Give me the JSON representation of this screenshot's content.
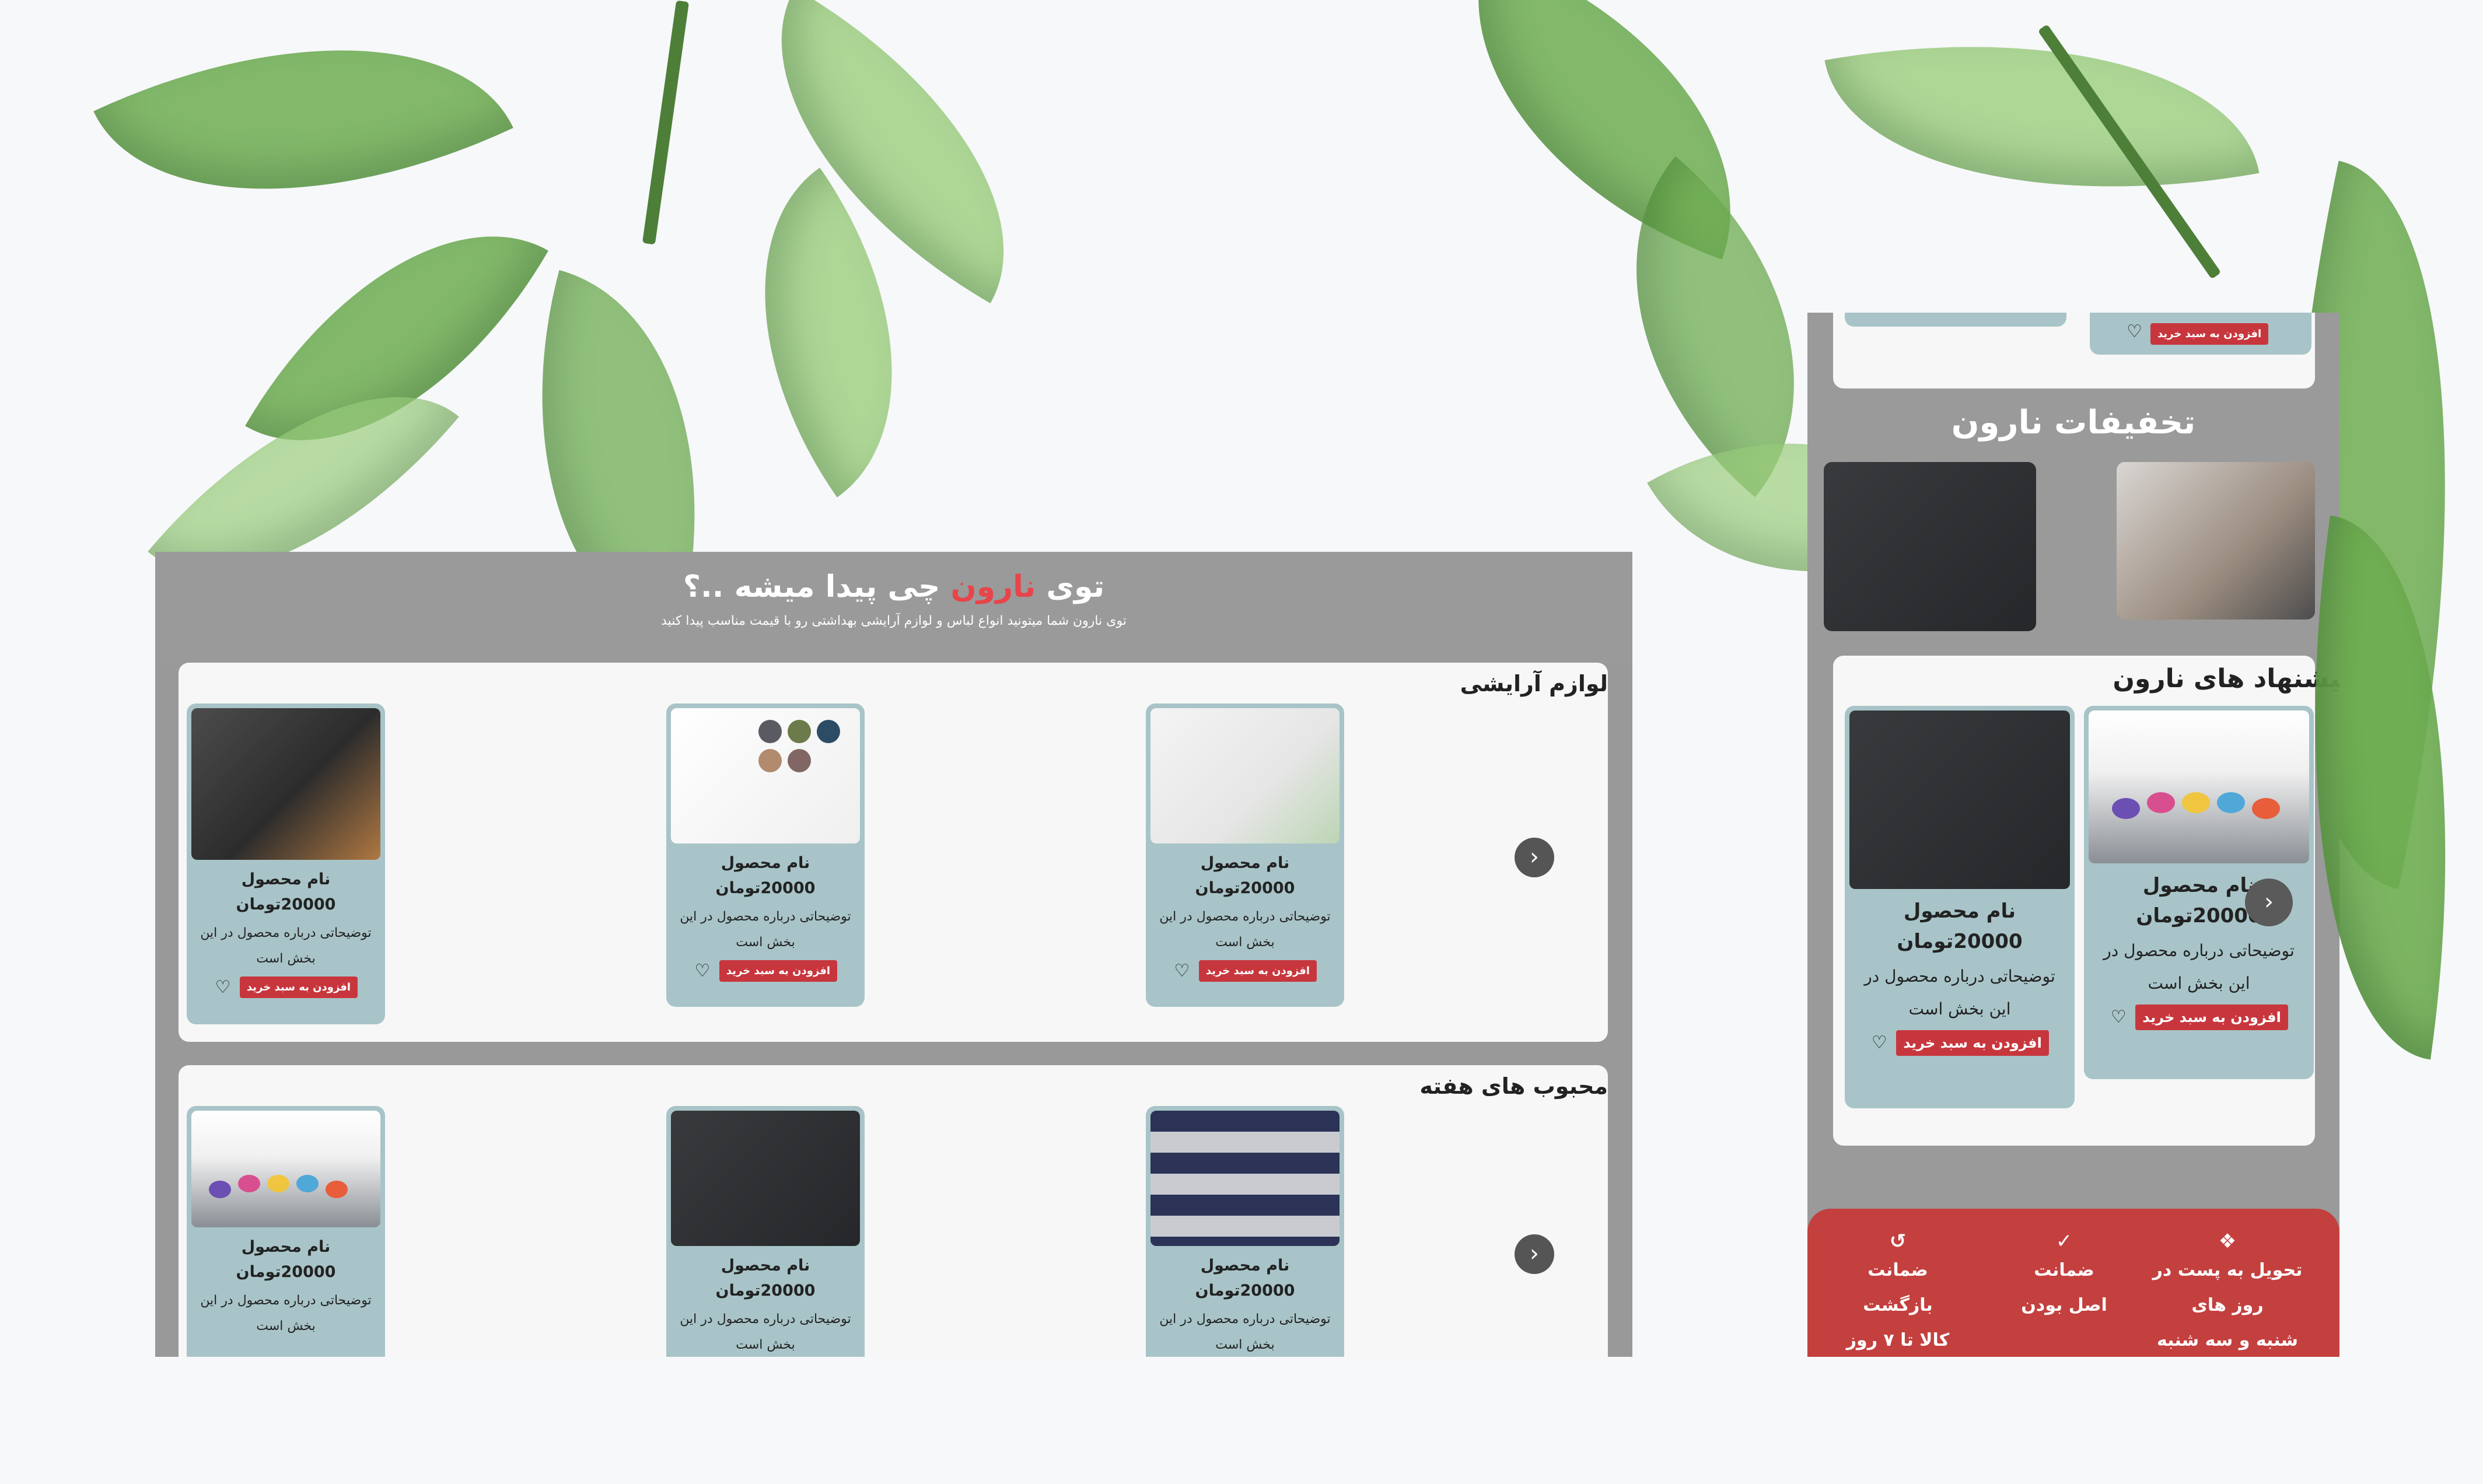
{
  "desktop": {
    "hero": {
      "title_pre": "توی ",
      "title_brand": "نارون",
      "title_post": " چی پیدا میشه ..؟",
      "subtitle": "توی نارون شما میتونید انواع لباس و لوازم آرایشی بهداشتی رو با قیمت مناسب پیدا کنید"
    },
    "sections": [
      {
        "title": "لوازم آرایشی",
        "products": [
          {
            "name": "نام محصول",
            "price": "20000تومان",
            "desc": "توضیحاتی درباره محصول در این بخش است",
            "add_label": "افزودن به سبد خرید"
          },
          {
            "name": "نام محصول",
            "price": "20000تومان",
            "desc": "توضیحاتی درباره محصول در این بخش است",
            "add_label": "افزودن به سبد خرید"
          },
          {
            "name": "نام محصول",
            "price": "20000تومان",
            "desc": "توضیحاتی درباره محصول در این بخش است",
            "add_label": "افزودن به سبد خرید"
          }
        ]
      },
      {
        "title": "محبوب های هفته",
        "products": [
          {
            "name": "نام محصول",
            "price": "20000تومان",
            "desc": "توضیحاتی درباره محصول در این بخش است",
            "add_label": ""
          },
          {
            "name": "نام محصول",
            "price": "20000تومان",
            "desc": "توضیحاتی درباره محصول در این بخش است",
            "add_label": ""
          },
          {
            "name": "نام محصول",
            "price": "20000تومان",
            "desc": "توضیحاتی درباره محصول در این بخش است",
            "add_label": ""
          }
        ]
      }
    ]
  },
  "mobile": {
    "top_add_label": "افزودن به سبد خرید",
    "discounts_title": "تخفیفات نارون",
    "suggest_title": "پیشنهاد های نارون",
    "products": [
      {
        "name": "نام محصول",
        "price": "20000تومان",
        "desc": "توضیحاتی درباره محصول در این بخش است",
        "add_label": "افزودن به سبد خرید"
      },
      {
        "name": "نام محصول",
        "price": "20000تومان",
        "desc": "توضیحاتی درباره محصول در این بخش است",
        "add_label": "افزودن به سبد خرید"
      }
    ],
    "features": [
      {
        "icon": "gift-icon",
        "line1": "تحویل به پست در روز های",
        "line2": "شنبه و سه شنبه"
      },
      {
        "icon": "check-icon",
        "line1": "ضمانت",
        "line2": "اصل بودن"
      },
      {
        "icon": "return-icon",
        "line1": "ضمانت بازگشت",
        "line2": "کالا تا ۷ روز"
      }
    ]
  },
  "colors": {
    "accent_red": "#c8363d",
    "brand_red": "#e8444a",
    "card_teal": "#a8c4c8",
    "frame_gray": "#9a9a9a",
    "footer_red": "#c3403f"
  }
}
